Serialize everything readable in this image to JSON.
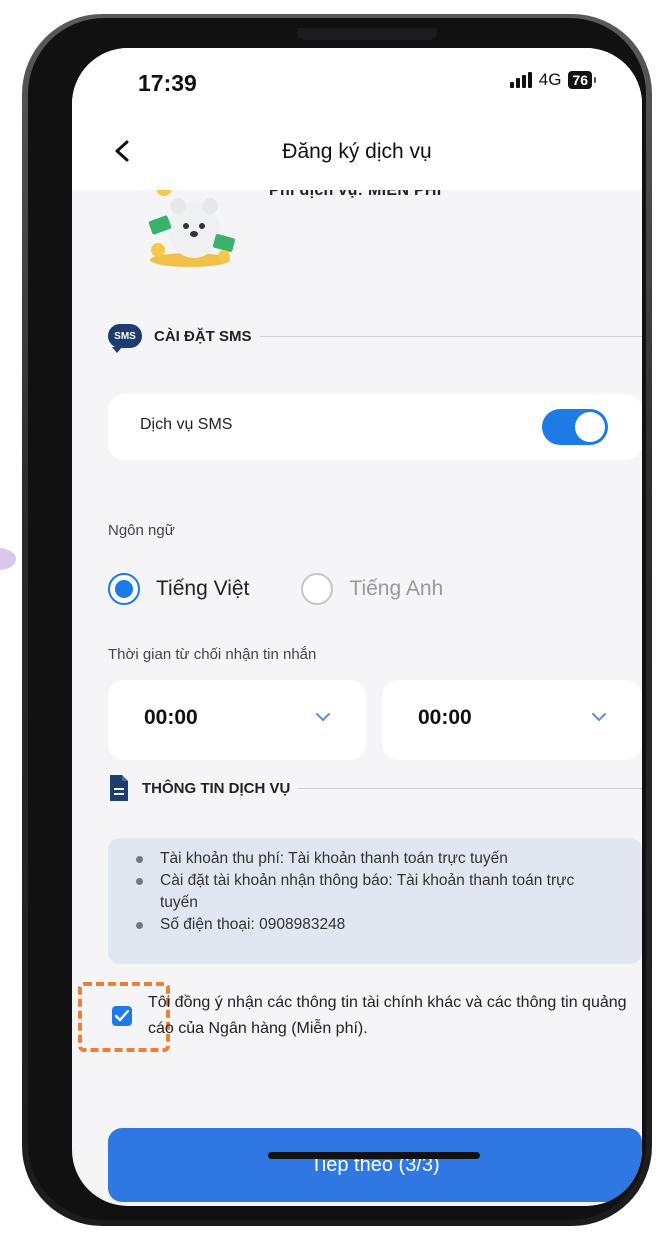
{
  "status_bar": {
    "time": "17:39",
    "network": "4G",
    "battery": "76"
  },
  "header": {
    "title": "Đăng ký dịch vụ"
  },
  "service_fee": "Phí dịch vụ: MIỄN PHÍ",
  "sms_section": {
    "title": "CÀI ĐẶT SMS",
    "icon_text": "SMS",
    "sms_service_label": "Dịch vụ SMS",
    "sms_service_enabled": true
  },
  "language": {
    "label": "Ngôn ngữ",
    "options": [
      "Tiếng Việt",
      "Tiếng Anh"
    ],
    "selected": "Tiếng Việt"
  },
  "refuse_time": {
    "label": "Thời gian từ chối nhận tin nhắn",
    "from": "00:00",
    "to": "00:00"
  },
  "service_info": {
    "title": "THÔNG TIN DỊCH VỤ",
    "items": [
      "Tài khoản thu phí: Tài khoản thanh toán trực tuyến",
      "Cài đặt tài khoản nhận thông báo: Tài khoản thanh toán trực tuyến",
      "Số điện thoại: 0908983248"
    ]
  },
  "consent": {
    "text": "Tôi đồng ý nhận các thông tin tài chính khác và các thông tin quảng cáo của Ngân hàng (Miễn phí).",
    "checked": true
  },
  "next_button": {
    "label": "Tiếp theo (3/3)"
  },
  "colors": {
    "primary": "#2f78e4",
    "highlight_dash": "#ee7f35",
    "info_bg": "#e1e6f1",
    "screen_bg": "#f5f5f7"
  }
}
